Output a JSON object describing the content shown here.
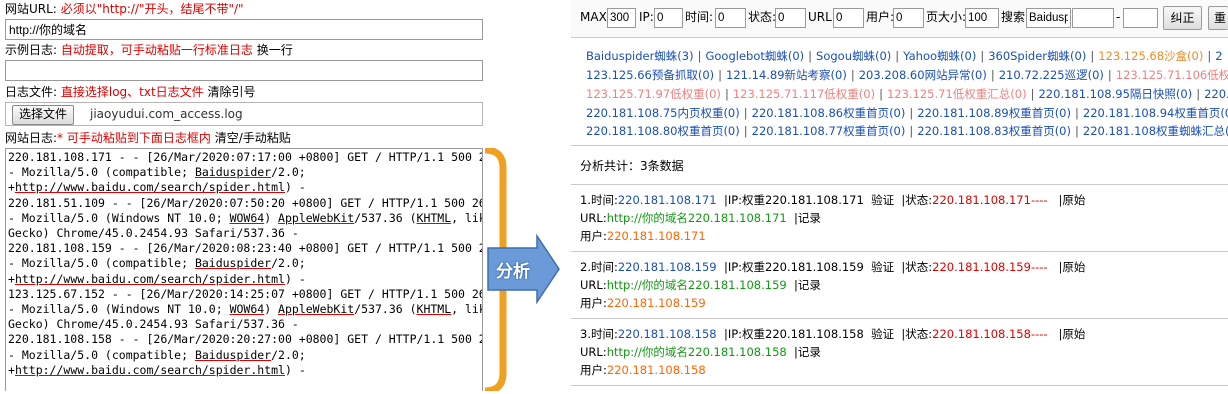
{
  "left": {
    "url_label": "网站URL:",
    "url_hint": "必须以\"http://\"开头，结尾不带\"/\"",
    "url_value": "http://你的域名",
    "sample_label": "示例日志:",
    "sample_hint": "自动提取，可手动粘贴一行标准日志",
    "sample_action": "换一行",
    "file_label": "日志文件:",
    "file_hint": "直接选择log、txt日志文件",
    "file_action": "清除引号",
    "choose_button": "选择文件",
    "file_name": "jiaoyudui.com_access.log",
    "log_label": "网站日志:",
    "log_star": "*",
    "log_hint": "可手动粘贴到下面日志框内",
    "log_action": "清空/手动粘贴",
    "log_lines": [
      "220.181.108.171 - - [26/Mar/2020:07:17:00 +0800] GET / HTTP/1.1 500 262",
      "- Mozilla/5.0 (compatible; Baiduspider/2.0;",
      "+http://www.baidu.com/search/spider.html) -",
      "220.181.51.109 - - [26/Mar/2020:07:50:20 +0800] GET / HTTP/1.1 500 262",
      "- Mozilla/5.0 (Windows NT 10.0; WOW64) AppleWebKit/537.36 (KHTML, like",
      "Gecko) Chrome/45.0.2454.93 Safari/537.36 -",
      "220.181.108.159 - - [26/Mar/2020:08:23:40 +0800] GET / HTTP/1.1 500 262",
      "- Mozilla/5.0 (compatible; Baiduspider/2.0;",
      "+http://www.baidu.com/search/spider.html) -",
      "123.125.67.152 - - [26/Mar/2020:14:25:07 +0800] GET / HTTP/1.1 500 262",
      "- Mozilla/5.0 (Windows NT 10.0; WOW64) AppleWebKit/537.36 (KHTML, like",
      "Gecko) Chrome/45.0.2454.93 Safari/537.36 -",
      "220.181.108.158 - - [26/Mar/2020:20:27:00 +0800] GET / HTTP/1.1 500 262",
      "- Mozilla/5.0 (compatible; Baiduspider/2.0;",
      "+http://www.baidu.com/search/spider.html) -"
    ]
  },
  "arrow": {
    "label": "分析",
    "color": "#f0a020",
    "box_color": "#5a8fd0"
  },
  "filter": {
    "max_label": "MAX:",
    "max_value": "300",
    "ip_label": "IP:",
    "ip_value": "0",
    "time_label": "时间:",
    "time_value": "0",
    "status_label": "状态:",
    "status_value": "0",
    "url_label": "URL:",
    "url_value": "0",
    "user_label": "用户:",
    "user_value": "0",
    "pagesize_label": "页大小:",
    "pagesize_value": "100",
    "search_label": "搜索:",
    "search_value": "Baidusp",
    "search_sep": "-",
    "fix_button": "纠正",
    "reset_button": "重"
  },
  "spiders": {
    "row1": [
      {
        "text": "Baiduspider蜘蛛(3)",
        "color": "#1a4fb8"
      },
      {
        "text": "Googlebot蜘蛛(0)",
        "color": "#1a4fb8"
      },
      {
        "text": "Sogou蜘蛛(0)",
        "color": "#1a4fb8"
      },
      {
        "text": "Yahoo蜘蛛(0)",
        "color": "#1a4fb8"
      },
      {
        "text": "360Spider蜘蛛(0)",
        "color": "#1a4fb8"
      },
      {
        "text": "123.125.68沙盒(0)",
        "color": "#f08a2a"
      },
      {
        "text": "2",
        "color": "#1a4fb8"
      }
    ],
    "row2": [
      {
        "text": "123.125.66预备抓取(0)",
        "color": "#1a4fb8"
      },
      {
        "text": "121.14.89新站考察(0)",
        "color": "#1a4fb8"
      },
      {
        "text": "203.208.60网站异常(0)",
        "color": "#1a4fb8"
      },
      {
        "text": "210.72.225巡逻(0)",
        "color": "#1a4fb8"
      },
      {
        "text": "123.125.71.106低权重",
        "color": "#f08080"
      }
    ],
    "row3": [
      {
        "text": "123.125.71.97低权重(0)",
        "color": "#f08080"
      },
      {
        "text": "123.125.71.117低权重(0)",
        "color": "#f08080"
      },
      {
        "text": "123.125.71低权重汇总(0)",
        "color": "#f08080"
      },
      {
        "text": "220.181.108.95隔日快照(0)",
        "color": "#1a4fb8"
      },
      {
        "text": "220.1",
        "color": "#1a4fb8"
      }
    ],
    "row4": [
      {
        "text": "220.181.108.75内页权重(0)",
        "color": "#1a4fb8"
      },
      {
        "text": "220.181.108.86权重首页(0)",
        "color": "#1a4fb8"
      },
      {
        "text": "220.181.108.89权重首页(0)",
        "color": "#1a4fb8"
      },
      {
        "text": "220.181.108.94权重首页(0)",
        "color": "#1a4fb8"
      }
    ],
    "row5": [
      {
        "text": "220.181.108.80权重首页(0)",
        "color": "#1a4fb8"
      },
      {
        "text": "220.181.108.77权重首页(0)",
        "color": "#1a4fb8"
      },
      {
        "text": "220.181.108.83权重首页(0)",
        "color": "#1a4fb8"
      },
      {
        "text": "220.181.108权重蜘蛛汇总(3",
        "color": "#1a4fb8"
      }
    ]
  },
  "summary": "分析共计：3条数据",
  "records": [
    {
      "index": "1",
      "time_label": "时间:",
      "ip": "220.181.108.171",
      "ip_label": "IP:权重",
      "verify": "验证",
      "status_label": "状态:",
      "status": "220.181.108.171----",
      "orig": "原始",
      "url_label": "URL:",
      "url": "http://你的域名220.181.108.171",
      "record": "记录",
      "user_label": "用户:",
      "user": "220.181.108.171"
    },
    {
      "index": "2",
      "time_label": "时间:",
      "ip": "220.181.108.159",
      "ip_label": "IP:权重",
      "verify": "验证",
      "status_label": "状态:",
      "status": "220.181.108.159----",
      "orig": "原始",
      "url_label": "URL:",
      "url": "http://你的域名220.181.108.159",
      "record": "记录",
      "user_label": "用户:",
      "user": "220.181.108.159"
    },
    {
      "index": "3",
      "time_label": "时间:",
      "ip": "220.181.108.158",
      "ip_label": "IP:权重",
      "verify": "验证",
      "status_label": "状态:",
      "status": "220.181.108.158----",
      "orig": "原始",
      "url_label": "URL:",
      "url": "http://你的域名220.181.108.158",
      "record": "记录",
      "user_label": "用户:",
      "user": "220.181.108.158"
    }
  ]
}
